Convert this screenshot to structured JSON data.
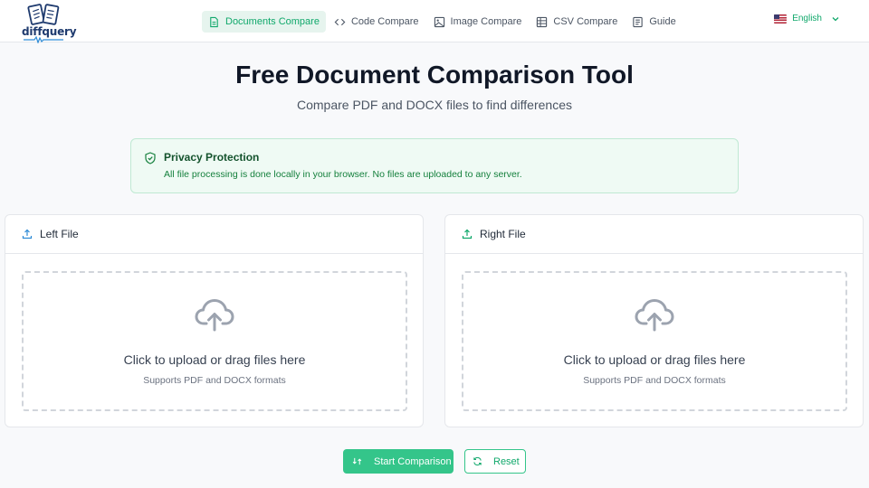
{
  "brand": {
    "name": "diffquery"
  },
  "nav": {
    "items": [
      {
        "label": "Documents Compare",
        "icon": "document-icon",
        "active": true
      },
      {
        "label": "Code Compare",
        "icon": "code-icon",
        "active": false
      },
      {
        "label": "Image Compare",
        "icon": "image-icon",
        "active": false
      },
      {
        "label": "CSV Compare",
        "icon": "table-icon",
        "active": false
      },
      {
        "label": "Guide",
        "icon": "book-icon",
        "active": false
      }
    ]
  },
  "language": {
    "label": "English",
    "flag": "us-flag-icon"
  },
  "hero": {
    "title": "Free Document Comparison Tool",
    "subtitle": "Compare PDF and DOCX files to find differences"
  },
  "privacy": {
    "title": "Privacy Protection",
    "text": "All file processing is done locally in your browser. No files are uploaded to any server."
  },
  "panels": {
    "left": {
      "title": "Left File",
      "drop_text": "Click to upload or drag files here",
      "drop_hint": "Supports PDF and DOCX formats"
    },
    "right": {
      "title": "Right File",
      "drop_text": "Click to upload or drag files here",
      "drop_hint": "Supports PDF and DOCX formats"
    }
  },
  "actions": {
    "start_label": "Start Comparison",
    "reset_label": "Reset"
  },
  "colors": {
    "accent": "#34c58a",
    "accent_text": "#10a86b",
    "brand_blue": "#1e3a6e",
    "privacy_bg": "#effaf4"
  }
}
